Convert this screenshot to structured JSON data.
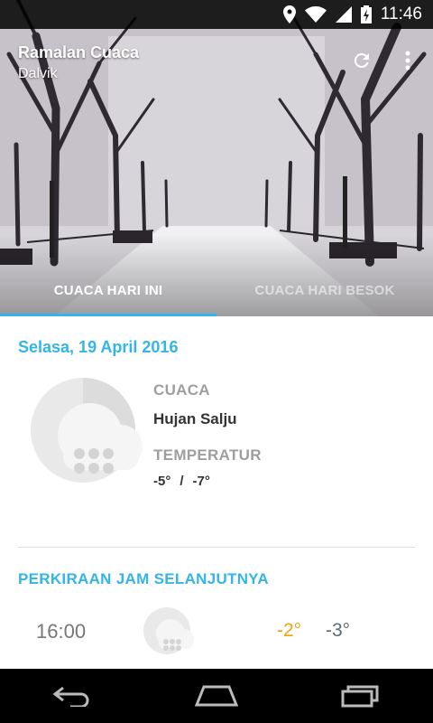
{
  "status_bar": {
    "time": "11:46",
    "icons": [
      "location-icon",
      "wifi-icon",
      "signal-icon",
      "battery-charging-icon"
    ]
  },
  "app": {
    "title": "Ramalan Cuaca",
    "location": "Dalvik",
    "actions": [
      "refresh-icon",
      "overflow-menu-icon"
    ]
  },
  "tabs": [
    {
      "label": "CUACA HARI INI",
      "active": true
    },
    {
      "label": "CUACA HARI BESOK",
      "active": false
    }
  ],
  "today": {
    "date": "Selasa, 19 April 2016",
    "weather_icon": "snow-cloud-icon",
    "weather_label": "CUACA",
    "weather_value": "Hujan Salju",
    "temperature_label": "TEMPERATUR",
    "temp_high": "-5°",
    "temp_separator": "/",
    "temp_low": "-7°"
  },
  "forecast": {
    "title": "PERKIRAAN JAM SELANJUTNYA",
    "items": [
      {
        "time": "16:00",
        "icon": "snow-cloud-icon",
        "max": "-2°",
        "min": "-3°"
      }
    ]
  },
  "colors": {
    "accent": "#33b5e5",
    "temp_max": "#f0a30a",
    "temp_min": "#5b6e78"
  },
  "nav_bar": [
    "back-icon",
    "home-icon",
    "recent-apps-icon"
  ]
}
